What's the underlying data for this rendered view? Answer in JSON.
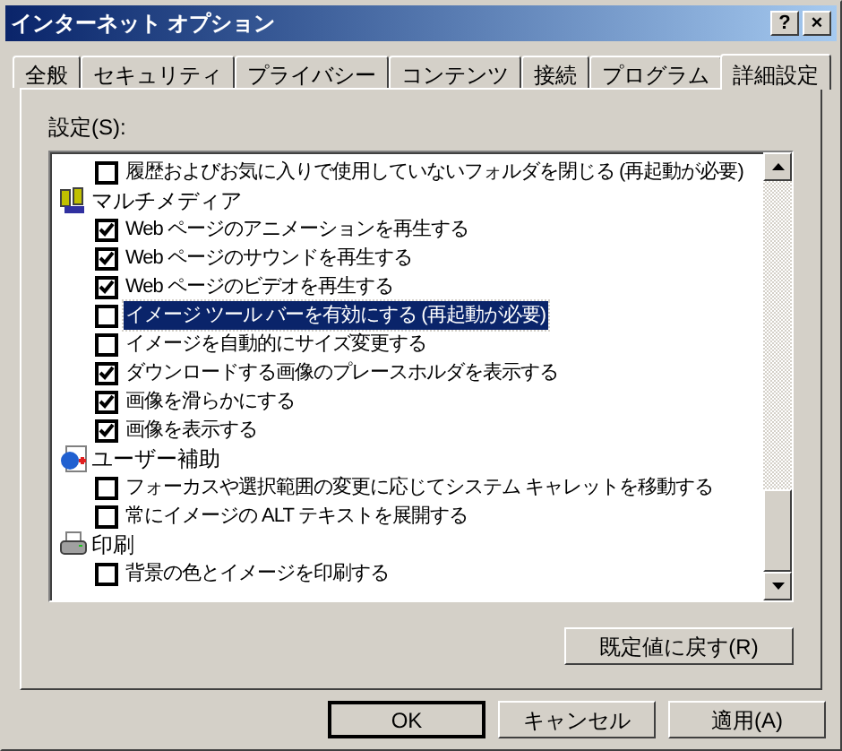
{
  "window": {
    "title": "インターネット オプション",
    "buttons": [
      "?",
      "×"
    ]
  },
  "tabs": [
    {
      "label": "全般",
      "selected": false
    },
    {
      "label": "セキュリティ",
      "selected": false
    },
    {
      "label": "プライバシー",
      "selected": false
    },
    {
      "label": "コンテンツ",
      "selected": false
    },
    {
      "label": "接続",
      "selected": false
    },
    {
      "label": "プログラム",
      "selected": false
    },
    {
      "label": "詳細設定",
      "selected": true
    }
  ],
  "settings_label": "設定(S):",
  "settings": [
    {
      "kind": "checkbox",
      "label": "履歴およびお気に入りで使用していないフォルダを閉じる (再起動が必要)",
      "checked": false,
      "selected": false
    },
    {
      "kind": "category",
      "label": "マルチメディア"
    },
    {
      "kind": "checkbox",
      "label": "Web ページのアニメーションを再生する",
      "checked": true,
      "selected": false
    },
    {
      "kind": "checkbox",
      "label": "Web ページのサウンドを再生する",
      "checked": true,
      "selected": false
    },
    {
      "kind": "checkbox",
      "label": "Web ページのビデオを再生する",
      "checked": true,
      "selected": false
    },
    {
      "kind": "checkbox",
      "label": "イメージ ツール バーを有効にする (再起動が必要)",
      "checked": false,
      "selected": true
    },
    {
      "kind": "checkbox",
      "label": "イメージを自動的にサイズ変更する",
      "checked": false,
      "selected": false
    },
    {
      "kind": "checkbox",
      "label": "ダウンロードする画像のプレースホルダを表示する",
      "checked": true,
      "selected": false
    },
    {
      "kind": "checkbox",
      "label": "画像を滑らかにする",
      "checked": true,
      "selected": false
    },
    {
      "kind": "checkbox",
      "label": "画像を表示する",
      "checked": true,
      "selected": false
    },
    {
      "kind": "category",
      "label": "ユーザー補助"
    },
    {
      "kind": "checkbox",
      "label": "フォーカスや選択範囲の変更に応じてシステム キャレットを移動する",
      "checked": false,
      "selected": false
    },
    {
      "kind": "checkbox",
      "label": "常にイメージの ALT テキストを展開する",
      "checked": false,
      "selected": false
    },
    {
      "kind": "category",
      "label": "印刷"
    },
    {
      "kind": "checkbox",
      "label": "背景の色とイメージを印刷する",
      "checked": false,
      "selected": false
    }
  ],
  "reset_button": "既定値に戻す(R)",
  "buttons": [
    {
      "label": "OK",
      "default": true
    },
    {
      "label": "キャンセル",
      "default": false
    },
    {
      "label": "適用(A)",
      "default": false
    }
  ]
}
